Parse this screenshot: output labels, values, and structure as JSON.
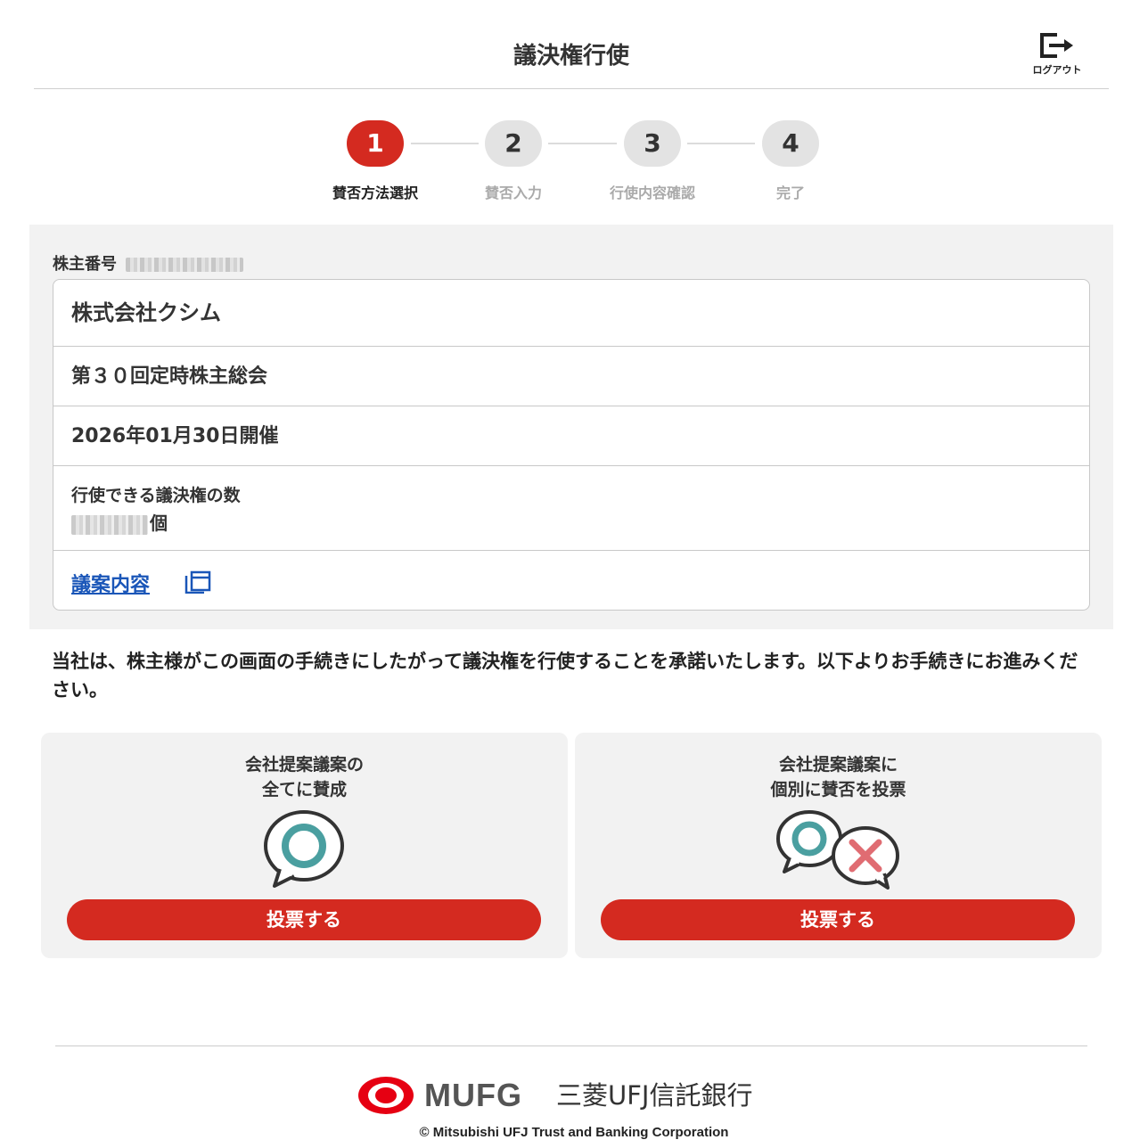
{
  "header": {
    "title": "議決権行使",
    "logout_label": "ログアウト"
  },
  "stepper": {
    "steps": [
      {
        "number": "1",
        "label": "賛否方法選択",
        "active": true
      },
      {
        "number": "2",
        "label": "賛否入力",
        "active": false
      },
      {
        "number": "3",
        "label": "行使内容確認",
        "active": false
      },
      {
        "number": "4",
        "label": "完了",
        "active": false
      }
    ]
  },
  "info": {
    "shareholder_label": "株主番号",
    "company": "株式会社クシム",
    "meeting": "第３０回定時株主総会",
    "date": "2026年01月30日開催",
    "votes_label": "行使できる議決権の数",
    "votes_unit": "個",
    "proposal_link": "議案内容"
  },
  "notice": "当社は、株主様がこの画面の手続きにしたがって議決権を行使することを承諾いたします。以下よりお手続きにお進みください。",
  "choices": {
    "approve_all": {
      "line1": "会社提案議案の",
      "line2": "全てに賛成",
      "button": "投票する"
    },
    "individual": {
      "line1": "会社提案議案に",
      "line2": "個別に賛否を投票",
      "button": "投票する"
    }
  },
  "footer": {
    "brand": "MUFG",
    "bank_name": "三菱UFJ信託銀行",
    "copyright": "© Mitsubishi UFJ Trust and Banking Corporation"
  },
  "colors": {
    "accent": "#d42a20",
    "link": "#1a56b8",
    "panel": "#f2f2f2",
    "teal": "#4a9fa0",
    "cross": "#e06c72"
  }
}
